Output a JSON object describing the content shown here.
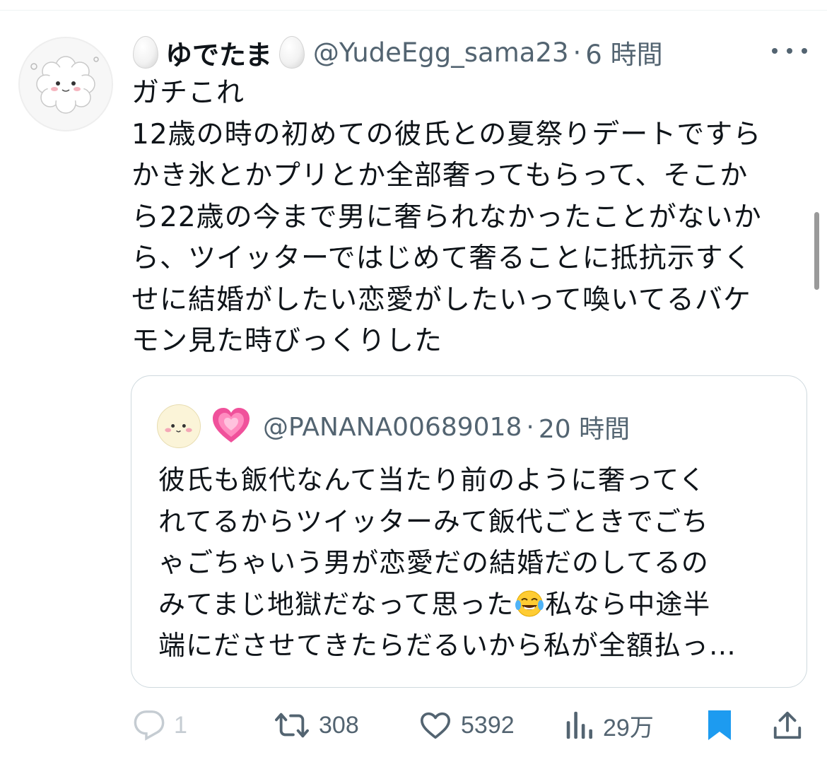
{
  "colors": {
    "text": "#0f1419",
    "secondary": "#536471",
    "border": "#cfd9de",
    "bookmark": "#1d9bf0",
    "heart_emoji": "#f0519b"
  },
  "tweet": {
    "avatar_icon": "fluffy-sheep-avatar-icon",
    "name_prefix_emoji": "egg-emoji-icon",
    "display_name": "ゆでたま",
    "name_suffix_emoji": "egg-emoji-icon",
    "handle": "@YudeEgg_sama23",
    "separator": "·",
    "time": "6 時間",
    "more_icon": "more-horizontal-icon",
    "text": "ガチこれ\n12歳の時の初めての彼氏との夏祭りデートですら\nかき氷とかプリとか全部奢ってもらって、そこか\nら22歳の今まで男に奢られなかったことがないか\nら、ツイッターではじめて奢ることに抵抗示すく\nせに結婚がしたい恋愛がしたいって喚いてるバケ\nモン見た時びっくりした"
  },
  "quote": {
    "avatar_icon": "baby-face-avatar-icon",
    "name_emoji": "growing-heart-emoji-icon",
    "handle": "@PANANA00689018",
    "separator": "·",
    "time": "20 時間",
    "text_before_emoji": "彼氏も飯代なんて当たり前のように奢ってく\nれてるからツイッターみて飯代ごときでごち\nゃごちゃいう男が恋愛だの結婚だのしてるの\nみてまじ地獄だなって思った",
    "inline_emoji": "tears-of-joy-emoji-icon",
    "text_after_emoji": "私なら中途半\n端にださせてきたらだるいから私が全額払っ…"
  },
  "actions": {
    "reply": {
      "icon": "reply-icon",
      "count": "1"
    },
    "retweet": {
      "icon": "retweet-icon",
      "count": "308"
    },
    "like": {
      "icon": "heart-icon",
      "count": "5392"
    },
    "views": {
      "icon": "analytics-icon",
      "count": "29万"
    },
    "bookmark": {
      "icon": "bookmark-icon",
      "state": "bookmarked"
    },
    "share": {
      "icon": "share-icon"
    }
  }
}
